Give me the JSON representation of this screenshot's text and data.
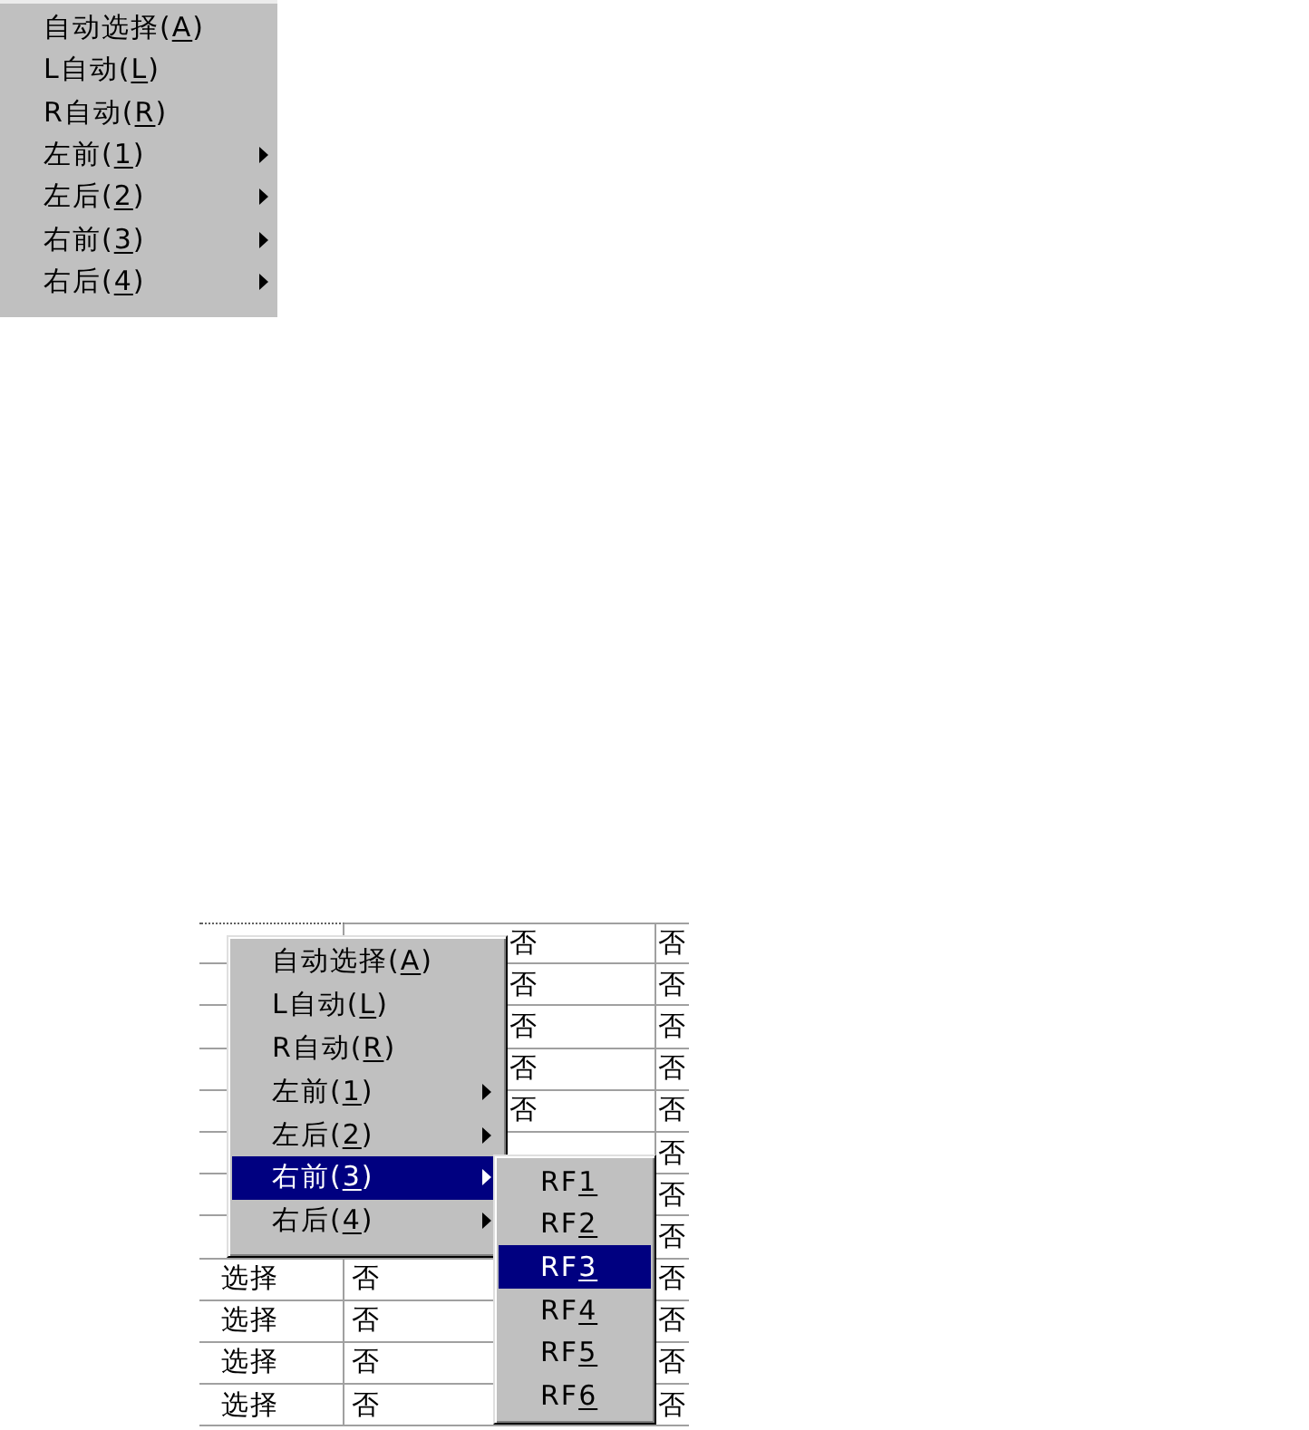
{
  "preview_menu": {
    "items": [
      {
        "text": "自动选择(",
        "access_key": "A",
        "suffix": ")",
        "has_submenu": false,
        "selected": false
      },
      {
        "text": "L自动(",
        "access_key": "L",
        "suffix": ")",
        "has_submenu": false,
        "selected": false
      },
      {
        "text": "R自动(",
        "access_key": "R",
        "suffix": ")",
        "has_submenu": false,
        "selected": false
      },
      {
        "text": "左前(",
        "access_key": "1",
        "suffix": ")",
        "has_submenu": true,
        "selected": false
      },
      {
        "text": "左后(",
        "access_key": "2",
        "suffix": ")",
        "has_submenu": true,
        "selected": false
      },
      {
        "text": "右前(",
        "access_key": "3",
        "suffix": ")",
        "has_submenu": true,
        "selected": false
      },
      {
        "text": "右后(",
        "access_key": "4",
        "suffix": ")",
        "has_submenu": true,
        "selected": false
      }
    ]
  },
  "grid": {
    "rows": [
      {
        "column_2": "否",
        "column_3": "否"
      },
      {
        "column_2": "否",
        "column_3": "否"
      },
      {
        "column_2": "否",
        "column_3": "否"
      },
      {
        "column_2": "否",
        "column_3": "否"
      },
      {
        "column_2": "否",
        "column_3": "否"
      },
      {
        "column_3": "否"
      },
      {
        "column_3": "否"
      },
      {
        "column_3": "否"
      },
      {
        "column_1": "选择",
        "column_2": "否",
        "column_3": "否"
      },
      {
        "column_1": "选择",
        "column_2": "否",
        "column_3": "否"
      },
      {
        "column_1": "选择",
        "column_2": "否",
        "column_3": "否"
      },
      {
        "column_1": "选择",
        "column_2": "否",
        "column_3": "否"
      }
    ]
  },
  "context_menu": {
    "items": [
      {
        "text": "自动选择(",
        "access_key": "A",
        "suffix": ")",
        "has_submenu": false,
        "selected": false
      },
      {
        "text": "L自动(",
        "access_key": "L",
        "suffix": ")",
        "has_submenu": false,
        "selected": false
      },
      {
        "text": "R自动(",
        "access_key": "R",
        "suffix": ")",
        "has_submenu": false,
        "selected": false
      },
      {
        "text": "左前(",
        "access_key": "1",
        "suffix": ")",
        "has_submenu": true,
        "selected": false
      },
      {
        "text": "左后(",
        "access_key": "2",
        "suffix": ")",
        "has_submenu": true,
        "selected": false
      },
      {
        "text": "右前(",
        "access_key": "3",
        "suffix": ")",
        "has_submenu": true,
        "selected": true,
        "submenu": {
          "items": [
            {
              "text": "RF",
              "access_key": "1",
              "selected": false
            },
            {
              "text": "RF",
              "access_key": "2",
              "selected": false
            },
            {
              "text": "RF",
              "access_key": "3",
              "selected": true
            },
            {
              "text": "RF",
              "access_key": "4",
              "selected": false
            },
            {
              "text": "RF",
              "access_key": "5",
              "selected": false
            },
            {
              "text": "RF",
              "access_key": "6",
              "selected": false
            }
          ]
        }
      },
      {
        "text": "右后(",
        "access_key": "4",
        "suffix": ")",
        "has_submenu": true,
        "selected": false
      }
    ]
  }
}
